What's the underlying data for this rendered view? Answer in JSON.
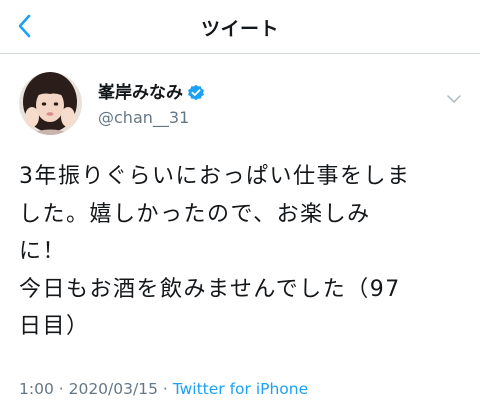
{
  "header": {
    "title": "ツイート",
    "back_icon": "chevron-left-icon",
    "accent_color": "#1da1f2"
  },
  "tweet": {
    "author": {
      "display_name": "峯岸みなみ",
      "handle": "@chan__31",
      "verified_icon": "verified-badge-icon"
    },
    "menu_icon": "chevron-down-icon",
    "text_lines": [
      "3年振りぐらいにおっぱい仕事をしま",
      "した。嬉しかったので、お楽しみ",
      "に！",
      "今日もお酒を飲みませんでした（97",
      "日目）"
    ],
    "meta": {
      "time": "1:00",
      "separator": " · ",
      "date": "2020/03/15",
      "source": "Twitter for iPhone"
    }
  }
}
